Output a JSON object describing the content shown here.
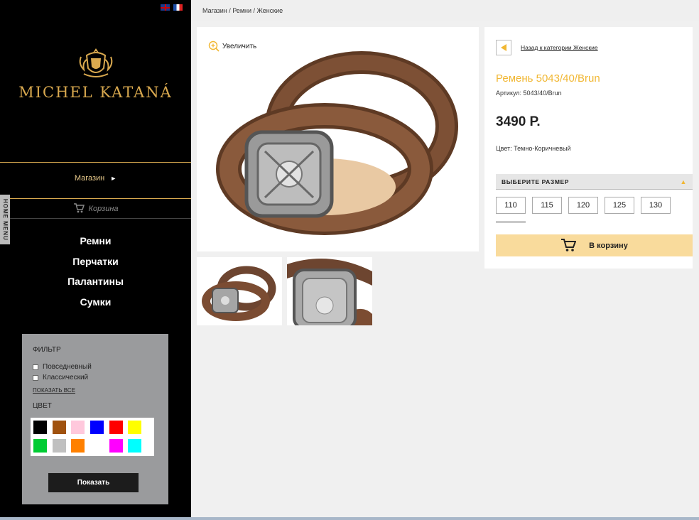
{
  "sidebar": {
    "brand": "MICHEL KATANÁ",
    "shop_label": "Магазин",
    "shop_arrow": "►",
    "cart_label": "Корзина",
    "home_menu": "HOME MENU",
    "categories": [
      "Ремни",
      "Перчатки",
      "Палантины",
      "Сумки"
    ]
  },
  "filter": {
    "title": "ФИЛЬТР",
    "options": [
      "Повседневный",
      "Классический"
    ],
    "show_all": "ПОКАЗАТЬ ВСЕ",
    "color_title": "ЦВЕТ",
    "colors": [
      "#000000",
      "#a0520f",
      "#ffc8dc",
      "#0000ff",
      "#ff0000",
      "#ffff00",
      "#00cc33",
      "#c0c0c0",
      "#ff8000",
      "#ffffff",
      "#ff00ff",
      "#00ffff"
    ],
    "submit": "Показать"
  },
  "breadcrumb": "Магазин / Ремни / Женские",
  "gallery": {
    "zoom_label": "Увеличить"
  },
  "product": {
    "back_label": "Назад к категории Женские",
    "name": "Ремень 5043/40/Brun",
    "sku": "Артикул: 5043/40/Brun",
    "price": "3490 Р.",
    "color": "Цвет: Темно-Коричневый",
    "size_heading": "ВЫБЕРИТЕ РАЗМЕР",
    "sizes": [
      "110",
      "115",
      "120",
      "125",
      "130"
    ],
    "add_to_cart": "В корзину"
  },
  "accent_color": "#f1b733"
}
